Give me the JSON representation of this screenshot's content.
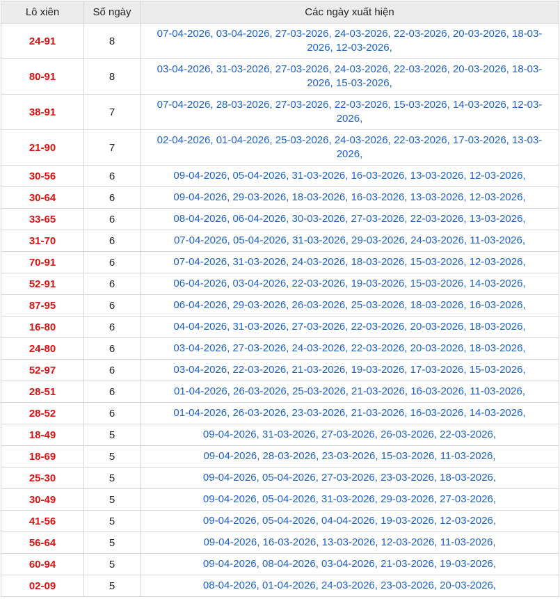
{
  "header": {
    "col_pair": "Lô xiên",
    "col_days": "Số ngày",
    "col_dates": "Các ngày xuất hiện"
  },
  "rows": [
    {
      "pair": "24-91",
      "days": "8",
      "dates": "07-04-2026, 03-04-2026, 27-03-2026, 24-03-2026, 22-03-2026, 20-03-2026, 18-03-2026, 12-03-2026,"
    },
    {
      "pair": "80-91",
      "days": "8",
      "dates": "03-04-2026, 31-03-2026, 27-03-2026, 24-03-2026, 22-03-2026, 20-03-2026, 18-03-2026, 15-03-2026,"
    },
    {
      "pair": "38-91",
      "days": "7",
      "dates": "07-04-2026, 28-03-2026, 27-03-2026, 22-03-2026, 15-03-2026, 14-03-2026, 12-03-2026,"
    },
    {
      "pair": "21-90",
      "days": "7",
      "dates": "02-04-2026, 01-04-2026, 25-03-2026, 24-03-2026, 22-03-2026, 17-03-2026, 13-03-2026,"
    },
    {
      "pair": "30-56",
      "days": "6",
      "dates": "09-04-2026, 05-04-2026, 31-03-2026, 16-03-2026, 13-03-2026, 12-03-2026,"
    },
    {
      "pair": "30-64",
      "days": "6",
      "dates": "09-04-2026, 29-03-2026, 18-03-2026, 16-03-2026, 13-03-2026, 12-03-2026,"
    },
    {
      "pair": "33-65",
      "days": "6",
      "dates": "08-04-2026, 06-04-2026, 30-03-2026, 27-03-2026, 22-03-2026, 13-03-2026,"
    },
    {
      "pair": "31-70",
      "days": "6",
      "dates": "07-04-2026, 05-04-2026, 31-03-2026, 29-03-2026, 24-03-2026, 11-03-2026,"
    },
    {
      "pair": "70-91",
      "days": "6",
      "dates": "07-04-2026, 31-03-2026, 24-03-2026, 18-03-2026, 15-03-2026, 12-03-2026,"
    },
    {
      "pair": "52-91",
      "days": "6",
      "dates": "06-04-2026, 03-04-2026, 22-03-2026, 19-03-2026, 15-03-2026, 14-03-2026,"
    },
    {
      "pair": "87-95",
      "days": "6",
      "dates": "06-04-2026, 29-03-2026, 26-03-2026, 25-03-2026, 18-03-2026, 16-03-2026,"
    },
    {
      "pair": "16-80",
      "days": "6",
      "dates": "04-04-2026, 31-03-2026, 27-03-2026, 22-03-2026, 20-03-2026, 18-03-2026,"
    },
    {
      "pair": "24-80",
      "days": "6",
      "dates": "03-04-2026, 27-03-2026, 24-03-2026, 22-03-2026, 20-03-2026, 18-03-2026,"
    },
    {
      "pair": "52-97",
      "days": "6",
      "dates": "03-04-2026, 22-03-2026, 21-03-2026, 19-03-2026, 17-03-2026, 15-03-2026,"
    },
    {
      "pair": "28-51",
      "days": "6",
      "dates": "01-04-2026, 26-03-2026, 25-03-2026, 21-03-2026, 16-03-2026, 11-03-2026,"
    },
    {
      "pair": "28-52",
      "days": "6",
      "dates": "01-04-2026, 26-03-2026, 23-03-2026, 21-03-2026, 16-03-2026, 14-03-2026,"
    },
    {
      "pair": "18-49",
      "days": "5",
      "dates": "09-04-2026, 31-03-2026, 27-03-2026, 26-03-2026, 22-03-2026,"
    },
    {
      "pair": "18-69",
      "days": "5",
      "dates": "09-04-2026, 28-03-2026, 23-03-2026, 15-03-2026, 11-03-2026,"
    },
    {
      "pair": "25-30",
      "days": "5",
      "dates": "09-04-2026, 05-04-2026, 27-03-2026, 23-03-2026, 18-03-2026,"
    },
    {
      "pair": "30-49",
      "days": "5",
      "dates": "09-04-2026, 05-04-2026, 31-03-2026, 29-03-2026, 27-03-2026,"
    },
    {
      "pair": "41-56",
      "days": "5",
      "dates": "09-04-2026, 05-04-2026, 04-04-2026, 19-03-2026, 12-03-2026,"
    },
    {
      "pair": "56-64",
      "days": "5",
      "dates": "09-04-2026, 16-03-2026, 13-03-2026, 12-03-2026, 11-03-2026,"
    },
    {
      "pair": "60-94",
      "days": "5",
      "dates": "09-04-2026, 08-04-2026, 03-04-2026, 21-03-2026, 19-03-2026,"
    },
    {
      "pair": "02-09",
      "days": "5",
      "dates": "08-04-2026, 01-04-2026, 24-03-2026, 23-03-2026, 20-03-2026,"
    }
  ]
}
